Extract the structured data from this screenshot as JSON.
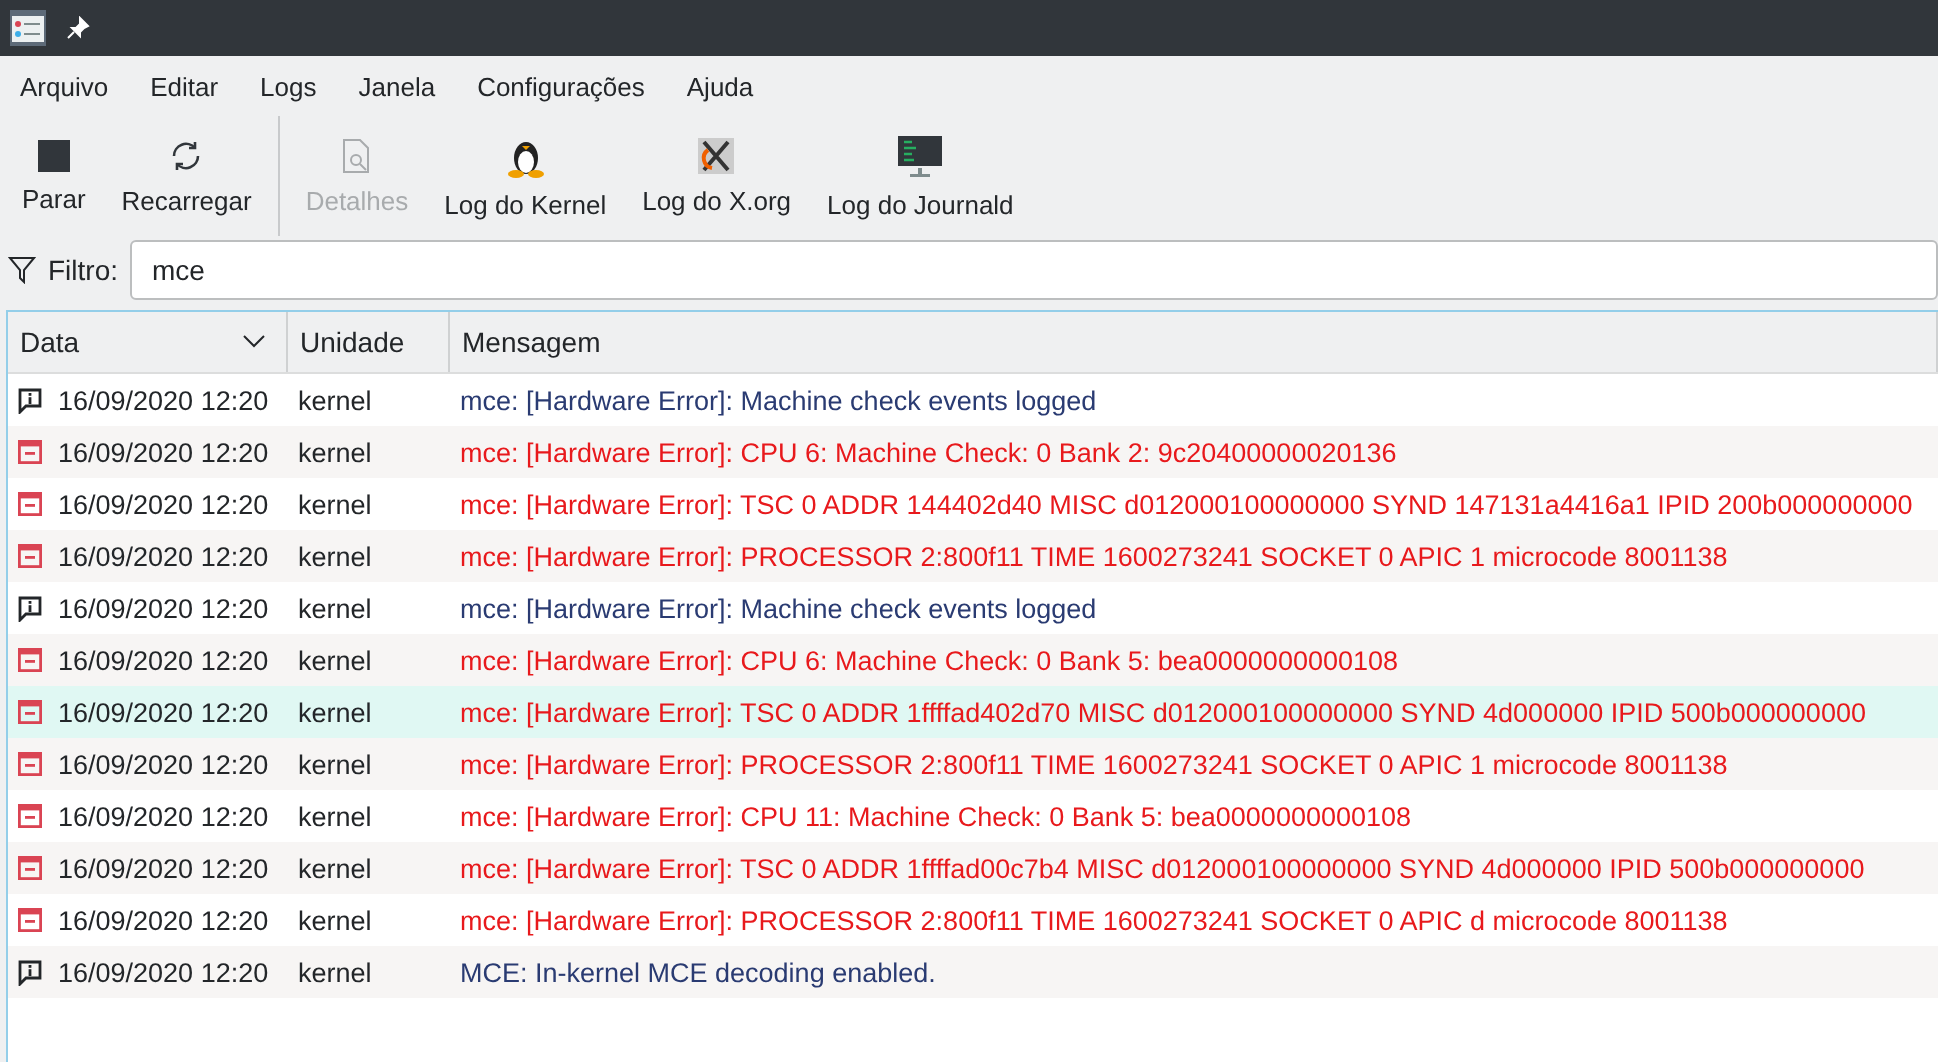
{
  "menu": [
    "Arquivo",
    "Editar",
    "Logs",
    "Janela",
    "Configurações",
    "Ajuda"
  ],
  "toolbar": [
    {
      "kind": "stop",
      "label": "Parar",
      "disabled": false
    },
    {
      "kind": "reload",
      "label": "Recarregar",
      "disabled": false
    },
    {
      "kind": "details",
      "label": "Detalhes",
      "disabled": true
    },
    {
      "kind": "kernel",
      "label": "Log do Kernel",
      "disabled": false
    },
    {
      "kind": "xorg",
      "label": "Log do X.org",
      "disabled": false
    },
    {
      "kind": "journal",
      "label": "Log do Journald",
      "disabled": false
    }
  ],
  "filter": {
    "label": "Filtro:",
    "value": "mce"
  },
  "table": {
    "columns": [
      "Data",
      "Unidade",
      "Mensagem"
    ],
    "rows": [
      {
        "kind": "info",
        "date": "16/09/2020 12:20",
        "unit": "kernel",
        "message": "mce: [Hardware Error]: Machine check events logged",
        "selected": false
      },
      {
        "kind": "error",
        "date": "16/09/2020 12:20",
        "unit": "kernel",
        "message": "mce: [Hardware Error]: CPU 6: Machine Check: 0 Bank 2: 9c20400000020136",
        "selected": false
      },
      {
        "kind": "error",
        "date": "16/09/2020 12:20",
        "unit": "kernel",
        "message": "mce: [Hardware Error]: TSC 0 ADDR 144402d40 MISC d012000100000000 SYND 147131a4416a1 IPID 200b000000000",
        "selected": false
      },
      {
        "kind": "error",
        "date": "16/09/2020 12:20",
        "unit": "kernel",
        "message": "mce: [Hardware Error]: PROCESSOR 2:800f11 TIME 1600273241 SOCKET 0 APIC 1 microcode 8001138",
        "selected": false
      },
      {
        "kind": "info",
        "date": "16/09/2020 12:20",
        "unit": "kernel",
        "message": "mce: [Hardware Error]: Machine check events logged",
        "selected": false
      },
      {
        "kind": "error",
        "date": "16/09/2020 12:20",
        "unit": "kernel",
        "message": "mce: [Hardware Error]: CPU 6: Machine Check: 0 Bank 5: bea0000000000108",
        "selected": false
      },
      {
        "kind": "error",
        "date": "16/09/2020 12:20",
        "unit": "kernel",
        "message": "mce: [Hardware Error]: TSC 0 ADDR 1ffffad402d70 MISC d012000100000000 SYND 4d000000 IPID 500b000000000",
        "selected": true
      },
      {
        "kind": "error",
        "date": "16/09/2020 12:20",
        "unit": "kernel",
        "message": "mce: [Hardware Error]: PROCESSOR 2:800f11 TIME 1600273241 SOCKET 0 APIC 1 microcode 8001138",
        "selected": false
      },
      {
        "kind": "error",
        "date": "16/09/2020 12:20",
        "unit": "kernel",
        "message": "mce: [Hardware Error]: CPU 11: Machine Check: 0 Bank 5: bea0000000000108",
        "selected": false
      },
      {
        "kind": "error",
        "date": "16/09/2020 12:20",
        "unit": "kernel",
        "message": "mce: [Hardware Error]: TSC 0 ADDR 1ffffad00c7b4 MISC d012000100000000 SYND 4d000000 IPID 500b000000000",
        "selected": false
      },
      {
        "kind": "error",
        "date": "16/09/2020 12:20",
        "unit": "kernel",
        "message": "mce: [Hardware Error]: PROCESSOR 2:800f11 TIME 1600273241 SOCKET 0 APIC d microcode 8001138",
        "selected": false
      },
      {
        "kind": "info",
        "date": "16/09/2020 12:20",
        "unit": "kernel",
        "message": "MCE: In-kernel MCE decoding enabled.",
        "selected": false
      }
    ]
  }
}
